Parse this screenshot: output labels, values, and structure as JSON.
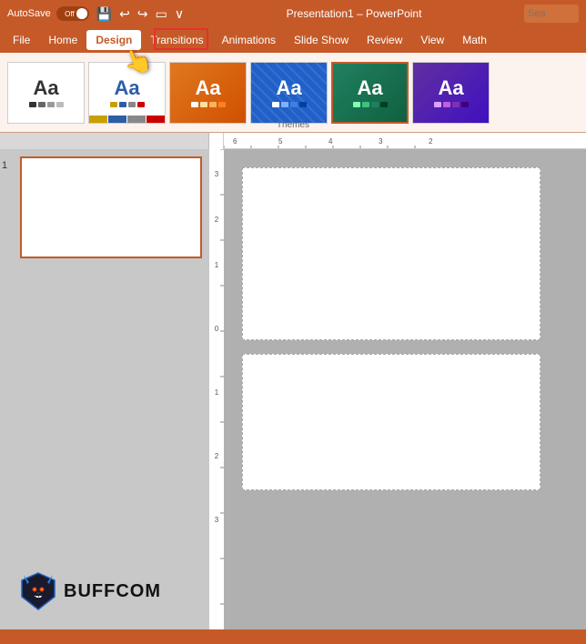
{
  "titlebar": {
    "autosave_label": "AutoSave",
    "autosave_state": "Off",
    "title": "Presentation1 – PowerPoint",
    "search_placeholder": "Sea"
  },
  "menubar": {
    "items": [
      "File",
      "Home",
      "Design",
      "Transitions",
      "Animations",
      "Slide Show",
      "Review",
      "View",
      "Math"
    ]
  },
  "ribbon": {
    "label": "Themes",
    "themes": [
      {
        "id": "t1",
        "label": "Aa"
      },
      {
        "id": "t2",
        "label": "Aa"
      },
      {
        "id": "t3",
        "label": "Aa"
      },
      {
        "id": "t4",
        "label": "Aa"
      },
      {
        "id": "t5",
        "label": "Aa"
      },
      {
        "id": "t6",
        "label": "Aa"
      }
    ]
  },
  "slide_panel": {
    "slide_number": "1"
  },
  "buffcom": {
    "text": "BUFFCOM"
  },
  "statusbar": {
    "text": ""
  }
}
